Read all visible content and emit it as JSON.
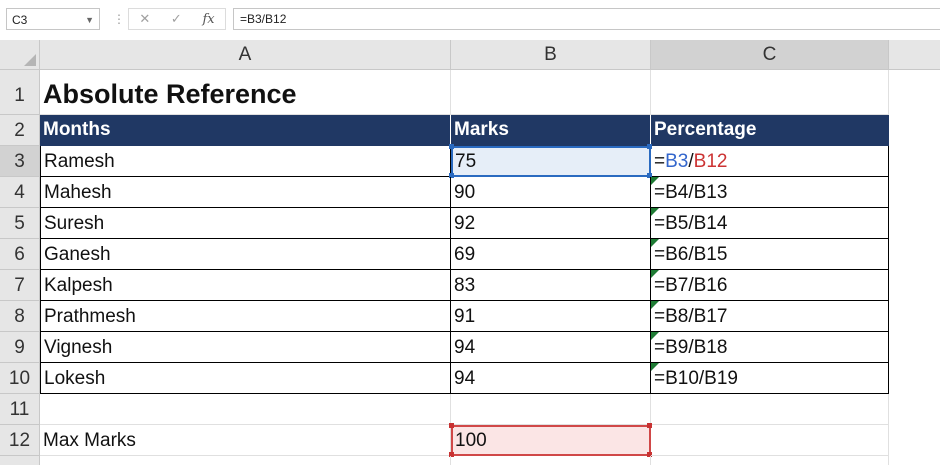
{
  "formula_bar": {
    "name_box": "C3",
    "formula": "=B3/B12",
    "cancel_icon": "✕",
    "enter_icon": "✓",
    "fx_label": "fx"
  },
  "columns": [
    "A",
    "B",
    "C"
  ],
  "rows": [
    "1",
    "2",
    "3",
    "4",
    "5",
    "6",
    "7",
    "8",
    "9",
    "10",
    "11",
    "12"
  ],
  "sheet": {
    "title": "Absolute Reference",
    "headers": {
      "a": "Months",
      "b": "Marks",
      "c": "Percentage"
    },
    "data": [
      {
        "name": "Ramesh",
        "marks": "75",
        "formula": "=B3/B12"
      },
      {
        "name": "Mahesh",
        "marks": "90",
        "formula": "=B4/B13"
      },
      {
        "name": "Suresh",
        "marks": "92",
        "formula": "=B5/B14"
      },
      {
        "name": "Ganesh",
        "marks": "69",
        "formula": "=B6/B15"
      },
      {
        "name": "Kalpesh",
        "marks": "83",
        "formula": "=B7/B16"
      },
      {
        "name": "Prathmesh",
        "marks": "91",
        "formula": "=B8/B17"
      },
      {
        "name": "Vignesh",
        "marks": "94",
        "formula": "=B9/B18"
      },
      {
        "name": "Lokesh",
        "marks": "94",
        "formula": "=B10/B19"
      }
    ],
    "max_label": "Max Marks",
    "max_value": "100",
    "c3_parts": {
      "eq": "=",
      "ref1": "B3",
      "slash": "/",
      "ref2": "B12"
    }
  },
  "colors": {
    "header_fill": "#203864",
    "selection": "#2a6ac0",
    "ref_red": "#cc3333",
    "ref_blue": "#3366cc"
  }
}
